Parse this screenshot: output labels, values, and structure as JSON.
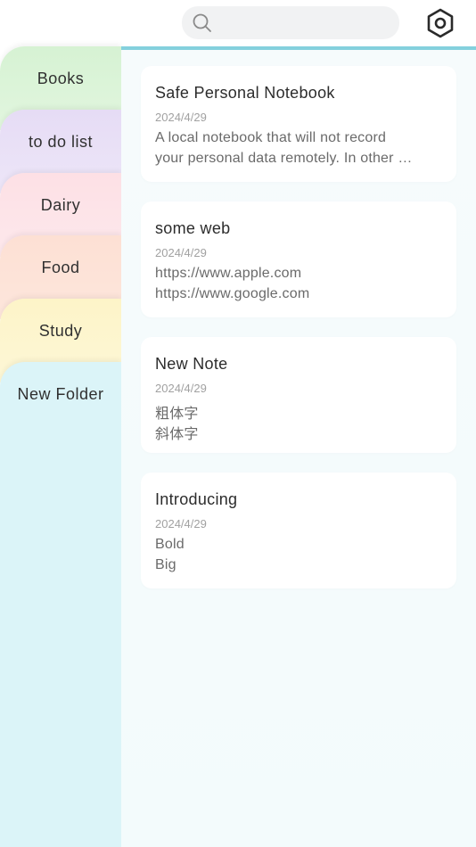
{
  "search": {
    "placeholder": "",
    "value": ""
  },
  "icons": {
    "search": "search-icon",
    "settings": "settings-hexagon-icon"
  },
  "colors": {
    "accent": "#84d0dd"
  },
  "folders": [
    {
      "label": "Books",
      "color": "#d6f2d3"
    },
    {
      "label": "to do list",
      "color": "#e6dcf5"
    },
    {
      "label": "Dairy",
      "color": "#fde0e5"
    },
    {
      "label": "Food",
      "color": "#fde0d4"
    },
    {
      "label": "Study",
      "color": "#fdf4c8"
    },
    {
      "label": "New Folder",
      "color": "#dbf4f8",
      "active": true
    }
  ],
  "notes": [
    {
      "title": "Safe Personal Notebook",
      "date": "2024/4/29",
      "lines": [
        "A local notebook that will not record",
        "your personal data remotely. In other …"
      ]
    },
    {
      "title": "some web",
      "date": "2024/4/29",
      "lines": [
        "https://www.apple.com",
        "https://www.google.com"
      ]
    },
    {
      "title": "New Note",
      "date": "2024/4/29",
      "lines": [
        "粗体字",
        "斜体字"
      ]
    },
    {
      "title": "Introducing",
      "date": "2024/4/29",
      "lines": [
        "Bold",
        "Big"
      ]
    }
  ]
}
